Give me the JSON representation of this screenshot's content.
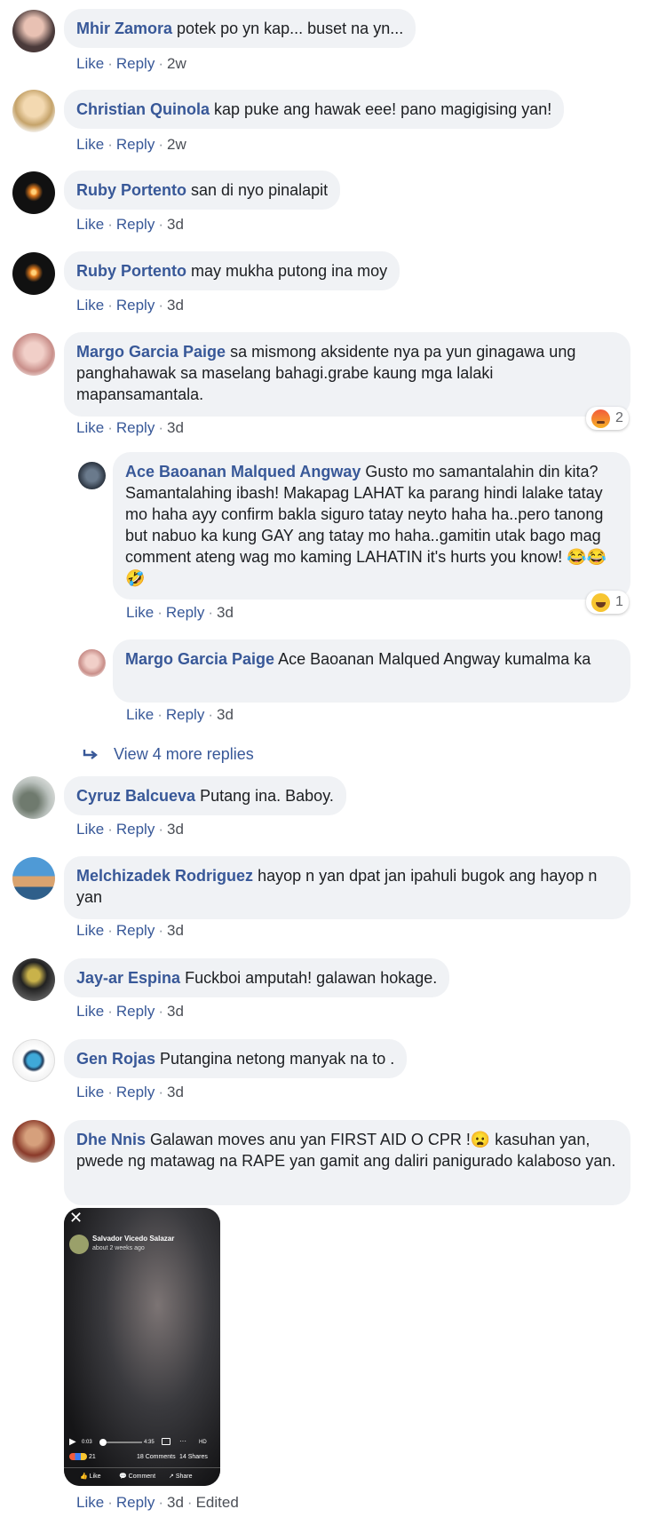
{
  "actions": {
    "like": "Like",
    "reply": "Reply",
    "dot": "·"
  },
  "comments": [
    {
      "author": "Mhir Zamora",
      "text": "potek po yn kap... buset na yn...",
      "time": "2w"
    },
    {
      "author": "Christian Quinola",
      "text": "kap puke ang hawak eee! pano magigising yan!",
      "time": "2w"
    },
    {
      "author": "Ruby Portento",
      "text": "san di nyo pinalapit",
      "time": "3d"
    },
    {
      "author": "Ruby Portento",
      "text": "may mukha putong ina moy",
      "time": "3d"
    },
    {
      "author": "Margo Garcia Paige",
      "text": "sa mismong aksidente nya pa yun ginagawa ung panghahawak sa maselang bahagi.grabe kaung mga lalaki mapansamantala.",
      "time": "3d",
      "reaction_count": "2"
    },
    {
      "author": "Cyruz Balcueva",
      "text": "Putang ina. Baboy.",
      "time": "3d"
    },
    {
      "author": "Melchizadek Rodriguez",
      "text": "hayop n yan dpat jan ipahuli bugok ang hayop n yan",
      "time": "3d"
    },
    {
      "author": "Jay-ar Espina",
      "text": "Fuckboi amputah! galawan hokage.",
      "time": "3d"
    },
    {
      "author": "Gen Rojas",
      "text": "Putangina netong manyak na to .",
      "time": "3d"
    },
    {
      "author": "Dhe Nnis",
      "text": "Galawan moves anu yan FIRST AID O CPR !😦 kasuhan yan, pwede ng matawag na RAPE yan gamit ang daliri panigurado kalaboso yan.",
      "time": "3d",
      "edited": "Edited"
    }
  ],
  "replies": [
    {
      "author": "Ace Baoanan Malqued Angway",
      "text": "Gusto mo samantalahin din kita? Samantalahing ibash! Makapag LAHAT ka parang hindi lalake tatay mo haha ayy confirm bakla siguro tatay neyto haha ha..pero tanong but nabuo ka kung GAY ang tatay mo haha..gamitin utak bago mag comment ateng wag mo kaming LAHATIN it's hurts you know! 😂😂🤣",
      "time": "3d",
      "reaction_count": "1"
    },
    {
      "author": "Margo Garcia Paige",
      "text": "Ace Baoanan Malqued Angway kumalma ka",
      "time": "3d"
    }
  ],
  "view_more": "View 4 more replies",
  "video": {
    "poster_name": "Salvador Vicedo Salazar",
    "poster_time": "about 2 weeks ago",
    "elapsed": "0:03",
    "duration": "4:35",
    "hd": "HD",
    "reactions_count": "21",
    "comments": "18 Comments",
    "shares": "14 Shares",
    "like": "Like",
    "comment": "Comment",
    "share": "Share"
  },
  "icons": {
    "reply_arrow": "reply-arrow-icon",
    "close": "close-icon",
    "play": "play-icon"
  },
  "colors": {
    "author": "#385898",
    "bubble": "#f0f2f5",
    "meta": "#4b4f56"
  }
}
